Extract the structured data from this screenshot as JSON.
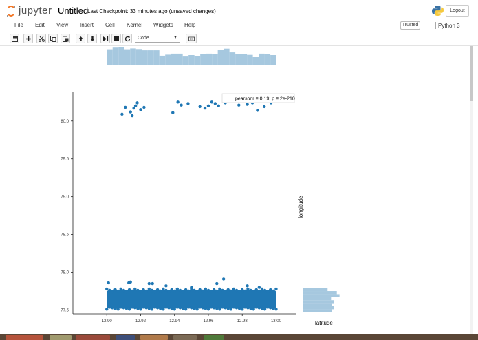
{
  "header": {
    "logo_text": "jupyter",
    "notebook_title": "Untitled",
    "checkpoint": "Last Checkpoint: 33 minutes ago (unsaved changes)",
    "logout_label": "Logout"
  },
  "menu": {
    "items": [
      "File",
      "Edit",
      "View",
      "Insert",
      "Cell",
      "Kernel",
      "Widgets",
      "Help"
    ],
    "trusted_label": "Trusted",
    "kernel_name": "Python 3"
  },
  "toolbar": {
    "cell_type": "Code",
    "icons": [
      "save-icon",
      "plus-icon",
      "cut-icon",
      "copy-icon",
      "paste-icon",
      "arrow-up-icon",
      "arrow-down-icon",
      "step-forward-icon",
      "stop-icon",
      "restart-icon",
      "keyboard-icon"
    ]
  },
  "chart_data": {
    "type": "scatter",
    "title": "",
    "xlabel": "latitude",
    "ylabel": "longitude",
    "xlim": [
      12.88,
      13.012
    ],
    "ylim": [
      77.45,
      80.38
    ],
    "x_ticks": [
      "12.90",
      "12.92",
      "12.94",
      "12.96",
      "12.98",
      "13.00"
    ],
    "y_ticks": [
      "77.5",
      "78.0",
      "78.5",
      "79.0",
      "79.5",
      "80.0"
    ],
    "annotation": "pearsonr = 0.19; p = 2e-210",
    "point_color": "#1f77b4",
    "hist_color": "#a6c8df",
    "dense_band": {
      "x": [
        12.9,
        13.0
      ],
      "y": [
        77.52,
        77.76
      ]
    },
    "scatter_points": [
      {
        "x": 12.901,
        "y": 77.86
      },
      {
        "x": 12.913,
        "y": 77.86
      },
      {
        "x": 12.914,
        "y": 77.87
      },
      {
        "x": 12.925,
        "y": 77.85
      },
      {
        "x": 12.927,
        "y": 77.85
      },
      {
        "x": 12.965,
        "y": 77.85
      },
      {
        "x": 12.969,
        "y": 77.91
      },
      {
        "x": 12.983,
        "y": 77.82
      },
      {
        "x": 12.99,
        "y": 77.8
      },
      {
        "x": 12.95,
        "y": 77.8
      },
      {
        "x": 12.935,
        "y": 77.82
      },
      {
        "x": 12.909,
        "y": 80.09
      },
      {
        "x": 12.911,
        "y": 80.18
      },
      {
        "x": 12.914,
        "y": 80.12
      },
      {
        "x": 12.915,
        "y": 80.07
      },
      {
        "x": 12.916,
        "y": 80.17
      },
      {
        "x": 12.917,
        "y": 80.2
      },
      {
        "x": 12.918,
        "y": 80.24
      },
      {
        "x": 12.92,
        "y": 80.15
      },
      {
        "x": 12.922,
        "y": 80.18
      },
      {
        "x": 12.939,
        "y": 80.11
      },
      {
        "x": 12.942,
        "y": 80.25
      },
      {
        "x": 12.944,
        "y": 80.21
      },
      {
        "x": 12.948,
        "y": 80.23
      },
      {
        "x": 12.955,
        "y": 80.19
      },
      {
        "x": 12.958,
        "y": 80.17
      },
      {
        "x": 12.96,
        "y": 80.2
      },
      {
        "x": 12.962,
        "y": 80.25
      },
      {
        "x": 12.964,
        "y": 80.23
      },
      {
        "x": 12.966,
        "y": 80.2
      },
      {
        "x": 12.97,
        "y": 80.24
      },
      {
        "x": 12.978,
        "y": 80.21
      },
      {
        "x": 12.983,
        "y": 80.22
      },
      {
        "x": 12.986,
        "y": 80.24
      },
      {
        "x": 12.987,
        "y": 80.27
      },
      {
        "x": 12.989,
        "y": 80.14
      },
      {
        "x": 12.993,
        "y": 80.19
      },
      {
        "x": 12.997,
        "y": 80.24
      },
      {
        "x": 12.999,
        "y": 80.26
      }
    ],
    "x_histogram": {
      "bin_start": 12.9,
      "bin_width": 0.00345,
      "counts": [
        0.78,
        0.86,
        0.88,
        0.78,
        0.82,
        0.79,
        0.73,
        0.73,
        0.73,
        0.47,
        0.52,
        0.57,
        0.57,
        0.43,
        0.5,
        0.44,
        0.54,
        0.57,
        0.56,
        0.74,
        0.81,
        0.63,
        0.56,
        0.54,
        0.51,
        0.4,
        0.57,
        0.55,
        0.5
      ]
    },
    "y_histogram": {
      "bins_y": [
        77.47,
        77.51,
        77.55,
        77.59,
        77.63,
        77.67,
        77.71,
        77.75
      ],
      "counts": [
        0.75,
        0.8,
        0.75,
        0.8,
        0.72,
        0.94,
        0.87,
        0.63
      ]
    }
  }
}
